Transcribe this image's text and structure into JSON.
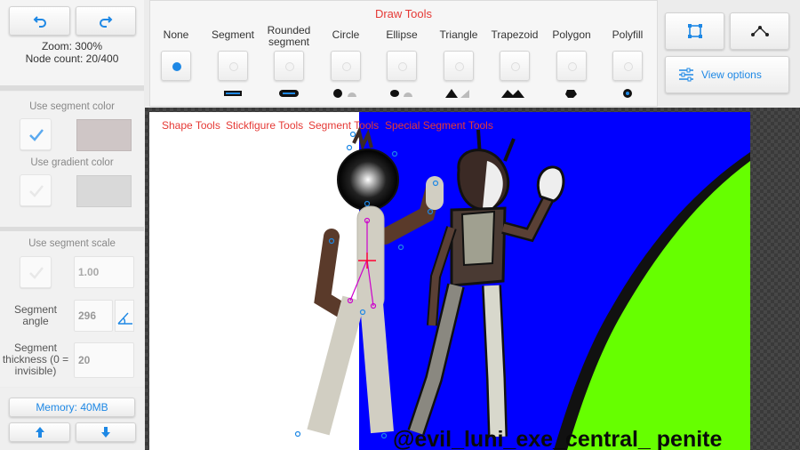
{
  "sidebar": {
    "undo": "undo-icon",
    "redo": "redo-icon",
    "zoom": "Zoom: 300%",
    "node_count": "Node count: 20/400",
    "use_segment_color": "Use segment color",
    "segment_color": "#cfc6c6",
    "use_gradient_color": "Use gradient color",
    "gradient_color": "#d9d9d9",
    "use_segment_scale": "Use segment scale",
    "scale_value": "1.00",
    "segment_angle_label": "Segment angle",
    "segment_angle_value": "296",
    "segment_thickness_label": "Segment thickness (0 = invisible)",
    "segment_thickness_value": "20",
    "memory": "Memory: 40MB"
  },
  "draw_tools": {
    "title": "Draw Tools",
    "tools": [
      {
        "label": "None",
        "selected": true
      },
      {
        "label": "Segment"
      },
      {
        "label": "Rounded segment"
      },
      {
        "label": "Circle"
      },
      {
        "label": "Ellipse"
      },
      {
        "label": "Triangle"
      },
      {
        "label": "Trapezoid"
      },
      {
        "label": "Polygon"
      },
      {
        "label": "Polyfill"
      }
    ]
  },
  "right_panel": {
    "select_icon": "square-select-icon",
    "nodes_icon": "node-path-icon",
    "view_options": "View options"
  },
  "tool_tabs": [
    "Shape Tools",
    "Stickfigure Tools",
    "Segment Tools",
    "Special Segment Tools"
  ],
  "canvas": {
    "watermark": "@evil_luni_exe_central_ penite",
    "colors": {
      "sky": "#0000ff",
      "grass": "#66ff00",
      "accent": "#1e88e5",
      "tab_red": "#e53935"
    }
  }
}
